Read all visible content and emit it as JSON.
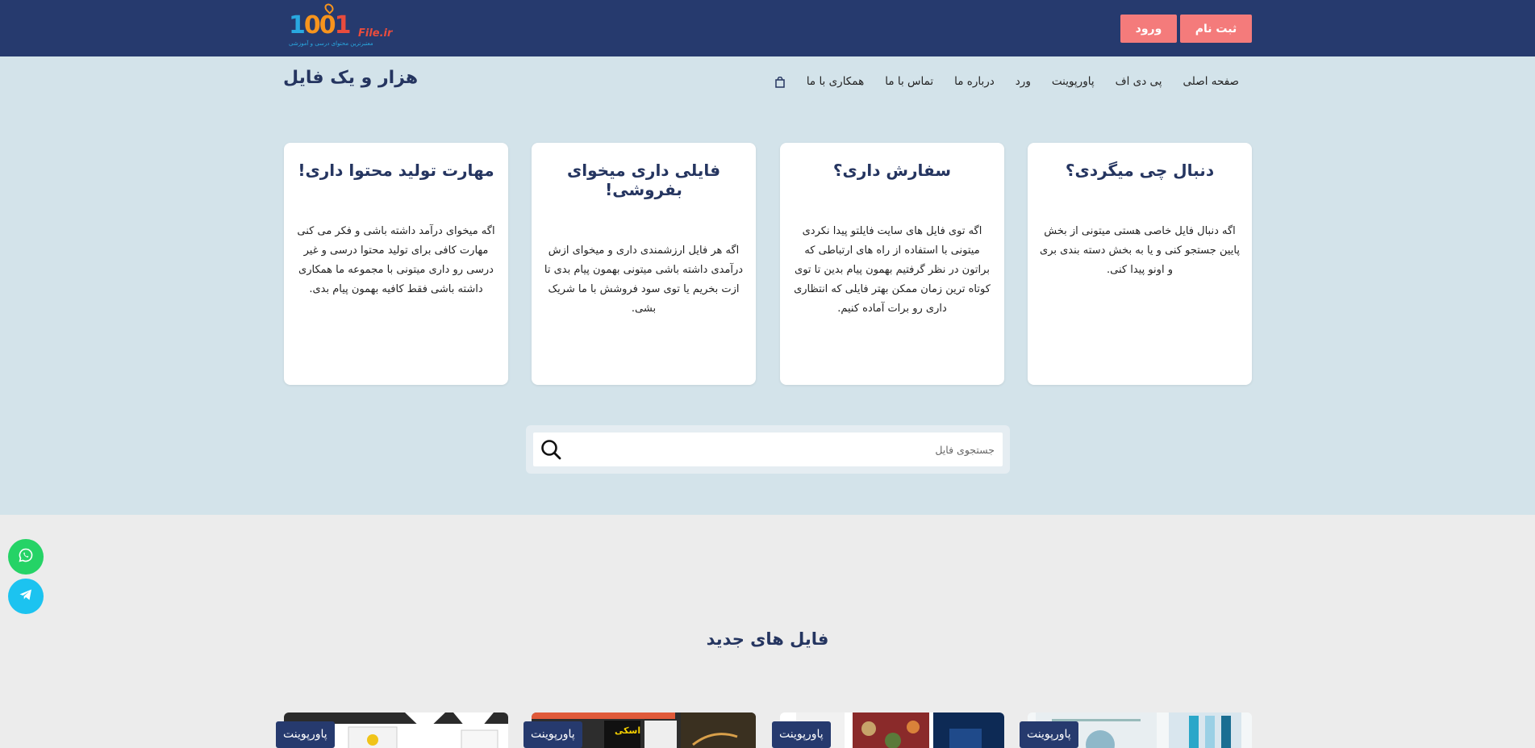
{
  "header": {
    "logo": {
      "number": "1001",
      "suffix": "File.ir",
      "tagline": "معتبرترین محتوای درسی و آموزشی"
    },
    "login_label": "ورود",
    "register_label": "ثبت نام"
  },
  "site_title": "هزار و یک فایل",
  "nav": {
    "items": [
      "صفحه اصلی",
      "پی دی اف",
      "پاورپوینت",
      "ورد",
      "درباره ما",
      "تماس با ما",
      "همکاری با ما"
    ],
    "cart_icon": "shopping-bag-icon"
  },
  "cards": [
    {
      "title": "دنبال چی میگردی؟",
      "text": "اگه دنبال فایل خاصی هستی میتونی از بخش پایین جستجو کنی و یا به بخش دسته بندی بری و اونو پیدا کنی."
    },
    {
      "title": "سفارش داری؟",
      "text": "اگه توی فایل های سایت فایلتو پیدا نکردی میتونی با استفاده از راه های ارتباطی که براتون در نظر گرفتیم بهمون پیام بدین تا توی کوتاه ترین زمان ممکن بهتر فایلی که انتظاری داری رو برات آماده کنیم."
    },
    {
      "title": "فایلی داری میخوای بفروشی!",
      "text": "اگه هر فایل ارزشمندی داری و میخوای ازش درآمدی داشته باشی میتونی بهمون پیام بدی تا ازت بخریم یا توی سود فروشش با ما شریک بشی."
    },
    {
      "title": "مهارت تولید محتوا داری!",
      "text": "اگه میخوای درآمد داشته باشی و فکر می کنی مهارت کافی برای تولید محتوا درسی و غیر درسی رو داری میتونی با مجموعه ما همکاری داشته باشی فقط کافیه بهمون پیام بدی."
    }
  ],
  "search": {
    "placeholder": "جستجوی فایل",
    "icon": "search-icon"
  },
  "social": {
    "whatsapp_icon": "whatsapp-icon",
    "telegram_icon": "telegram-icon",
    "whatsapp_color": "#25d366",
    "telegram_color": "#1cc3f0"
  },
  "new_files": {
    "title": "فایل های جدید",
    "items": [
      {
        "category": "پاورپوینت"
      },
      {
        "category": "پاورپوینت"
      },
      {
        "category": "پاورپوینت",
        "thumb_text": "اسکی"
      },
      {
        "category": "پاورپوینت"
      }
    ]
  },
  "colors": {
    "header_bg": "#263a6e",
    "hero_bg": "#d3e3ea",
    "accent_red": "#f47b7b",
    "brand_navy": "#253560"
  }
}
